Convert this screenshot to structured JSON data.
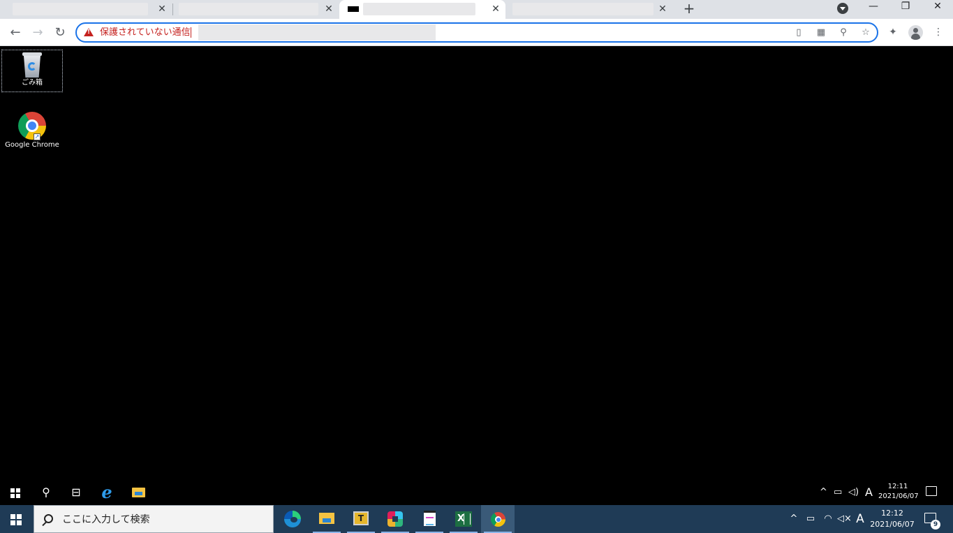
{
  "browser": {
    "tabs": [
      {
        "title": "",
        "close": "✕"
      },
      {
        "title": "",
        "close": "✕"
      },
      {
        "title": "",
        "close": "✕",
        "active": true
      },
      {
        "title": "",
        "close": "✕"
      }
    ],
    "new_tab": "+",
    "window_controls": {
      "minimize": "—",
      "restore": "❐",
      "close": "✕"
    },
    "nav": {
      "back": "←",
      "forward": "→",
      "reload": "↻"
    },
    "omnibox": {
      "security_text": "保護されていない通信",
      "url": ""
    },
    "omnibox_icons": [
      "clipboard-icon",
      "qr-code-icon",
      "zoom-icon",
      "bookmark-star-icon"
    ],
    "toolbar_icons": [
      "extensions-icon",
      "profile-icon",
      "menu-icon"
    ],
    "colors": {
      "accent": "#1a73e8",
      "warning": "#c5221f",
      "tabstrip": "#dee1e6"
    }
  },
  "remote_desktop": {
    "icons": [
      {
        "label": "ごみ箱",
        "icon": "recycle-bin-icon"
      },
      {
        "label": "Google Chrome",
        "icon": "chrome-icon"
      }
    ],
    "taskbar": {
      "tray_ime": "A",
      "clock_time": "12:11",
      "clock_date": "2021/06/07"
    }
  },
  "taskbar": {
    "search_placeholder": "ここに入力して検索",
    "apps": [
      "edge-icon",
      "file-explorer-icon",
      "t-app-icon",
      "slack-icon",
      "notepad-icon",
      "excel-icon",
      "chrome-icon"
    ],
    "excel_letter": "X",
    "t_app_letter": "T",
    "tray_ime": "A",
    "clock_time": "12:12",
    "clock_date": "2021/06/07",
    "notification_count": "9",
    "colors": {
      "background": "#1f3b56",
      "active_app": "#3a5a78"
    }
  }
}
